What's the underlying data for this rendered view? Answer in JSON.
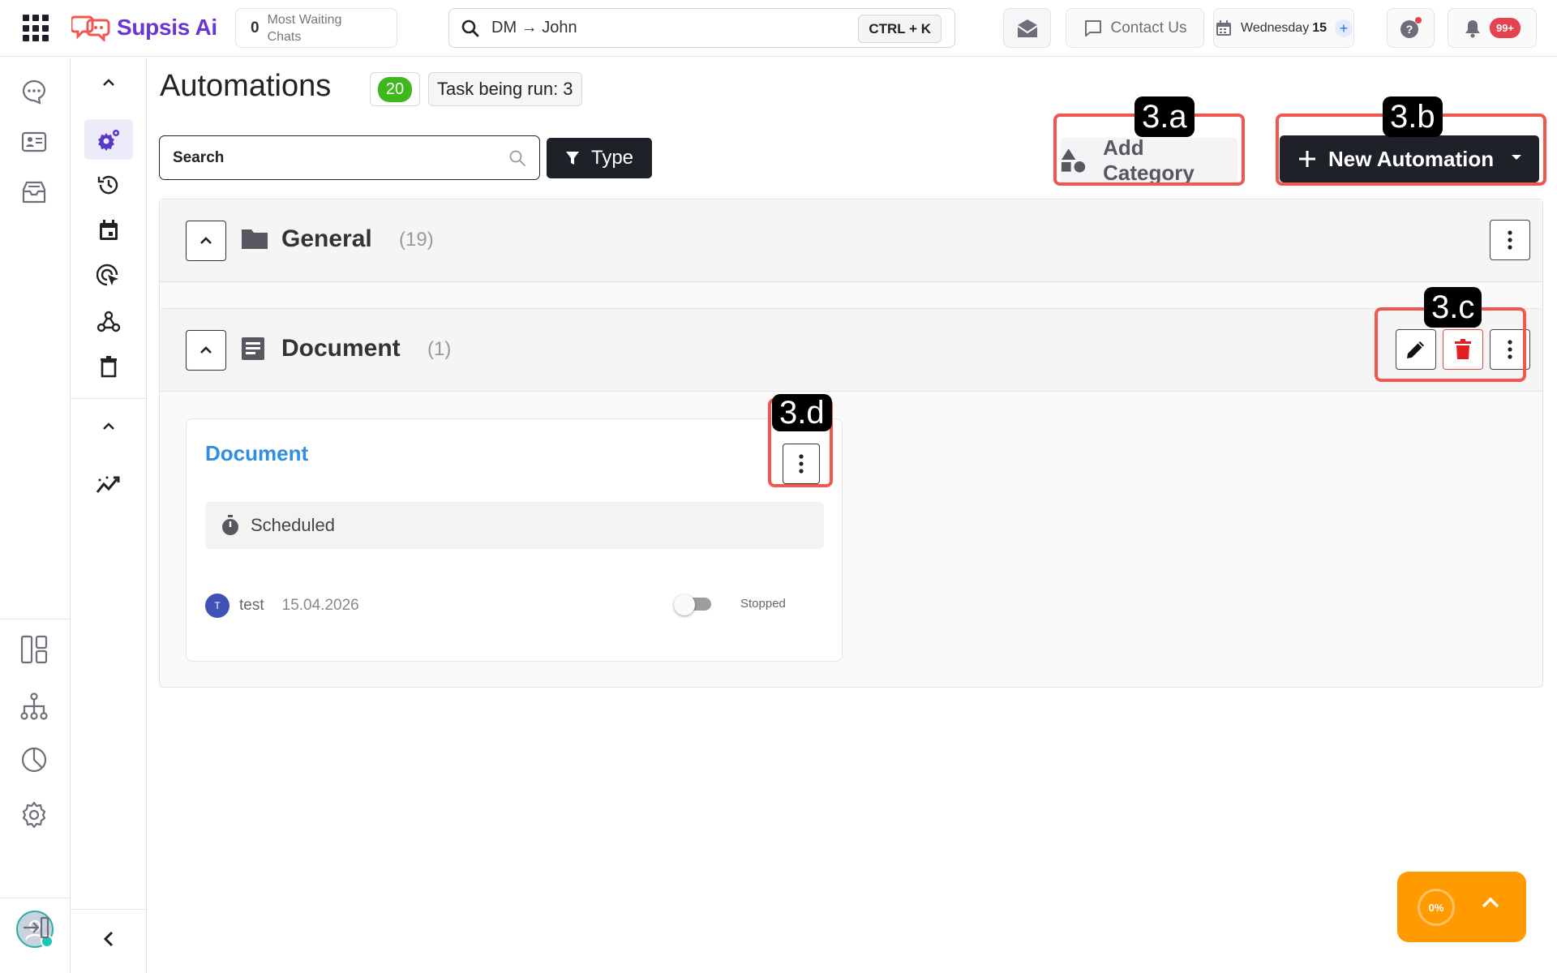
{
  "app": {
    "name": "Supsis Ai",
    "brand_color": "#6a35d8"
  },
  "topbar": {
    "waiting_count": "0",
    "waiting_label": "Most Waiting Chats",
    "search_value": "DM → John",
    "search_shortcut": "CTRL + K",
    "contact_label": "Contact Us",
    "date_label": "Wednesday",
    "date_day": "15",
    "notif_badge": "99+"
  },
  "icons": {
    "rail": [
      "chat-icon",
      "contacts-icon",
      "inbox-icon",
      "dashboard-icon",
      "hierarchy-icon",
      "reports-icon",
      "settings-icon",
      "logout-icon"
    ],
    "secondary_rail": [
      "automation-gear-icon",
      "history-icon",
      "calendar-icon",
      "click-target-icon",
      "webhook-icon",
      "trash-icon",
      "analytics-icon"
    ]
  },
  "page": {
    "title": "Automations",
    "count": "20",
    "task_badge": "Task being run: 3"
  },
  "toolbar": {
    "search_placeholder": "Search",
    "type_label": "Type",
    "add_category_label": "Add Category",
    "new_automation_label": "New Automation"
  },
  "callouts": {
    "a": "3.a",
    "b": "3.b",
    "c": "3.c",
    "d": "3.d",
    "color": "#f2574f"
  },
  "categories": [
    {
      "name": "General",
      "count": "(19)"
    },
    {
      "name": "Document",
      "count": "(1)"
    }
  ],
  "automation_card": {
    "title": "Document",
    "status": "Scheduled",
    "creator_initial": "T",
    "creator": "test",
    "date": "15.04.2026",
    "toggle_state": "Stopped",
    "enabled": false
  },
  "progress": {
    "percent_label": "0%",
    "value": 0
  }
}
